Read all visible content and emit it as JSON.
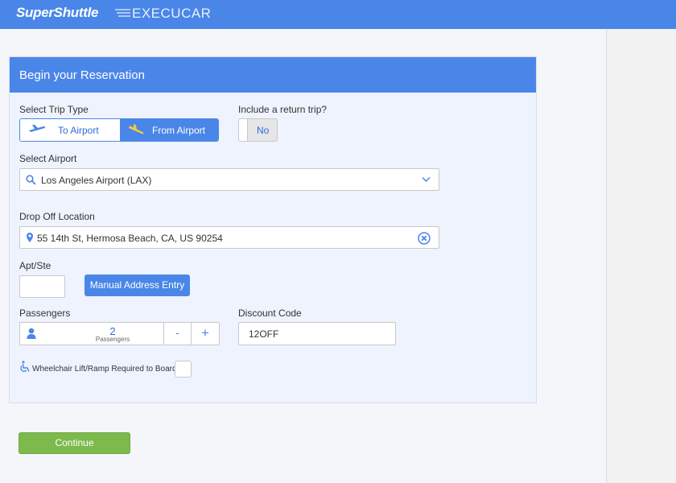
{
  "header": {
    "brand_primary": "SuperShuttle",
    "brand_secondary": "EXECUCAR",
    "accent_color": "#4a86e8"
  },
  "reservation": {
    "title": "Begin your Reservation",
    "trip_type": {
      "label": "Select Trip Type",
      "options": [
        {
          "label": "To Airport",
          "icon": "plane-takeoff-icon",
          "selected": false
        },
        {
          "label": "From Airport",
          "icon": "plane-landing-icon",
          "selected": true
        }
      ]
    },
    "return_trip": {
      "label": "Include a return trip?",
      "value": "No"
    },
    "airport": {
      "label": "Select Airport",
      "value": "Los Angeles Airport (LAX)"
    },
    "dropoff": {
      "label": "Drop Off Location",
      "value": "55 14th St, Hermosa Beach, CA, US 90254"
    },
    "apt": {
      "label": "Apt/Ste",
      "value": ""
    },
    "manual_address_button": "Manual Address Entry",
    "passengers": {
      "label": "Passengers",
      "count": "2",
      "unit": "Passengers",
      "minus": "-",
      "plus": "+"
    },
    "discount": {
      "label": "Discount Code",
      "value": "12OFF"
    },
    "wheelchair": {
      "label": "Wheelchair Lift/Ramp Required to Board",
      "checked": false
    }
  },
  "continue_button": "Continue",
  "colors": {
    "primary": "#4a86e8",
    "continue": "#7dba4c",
    "card_bg": "#eef3fd"
  }
}
